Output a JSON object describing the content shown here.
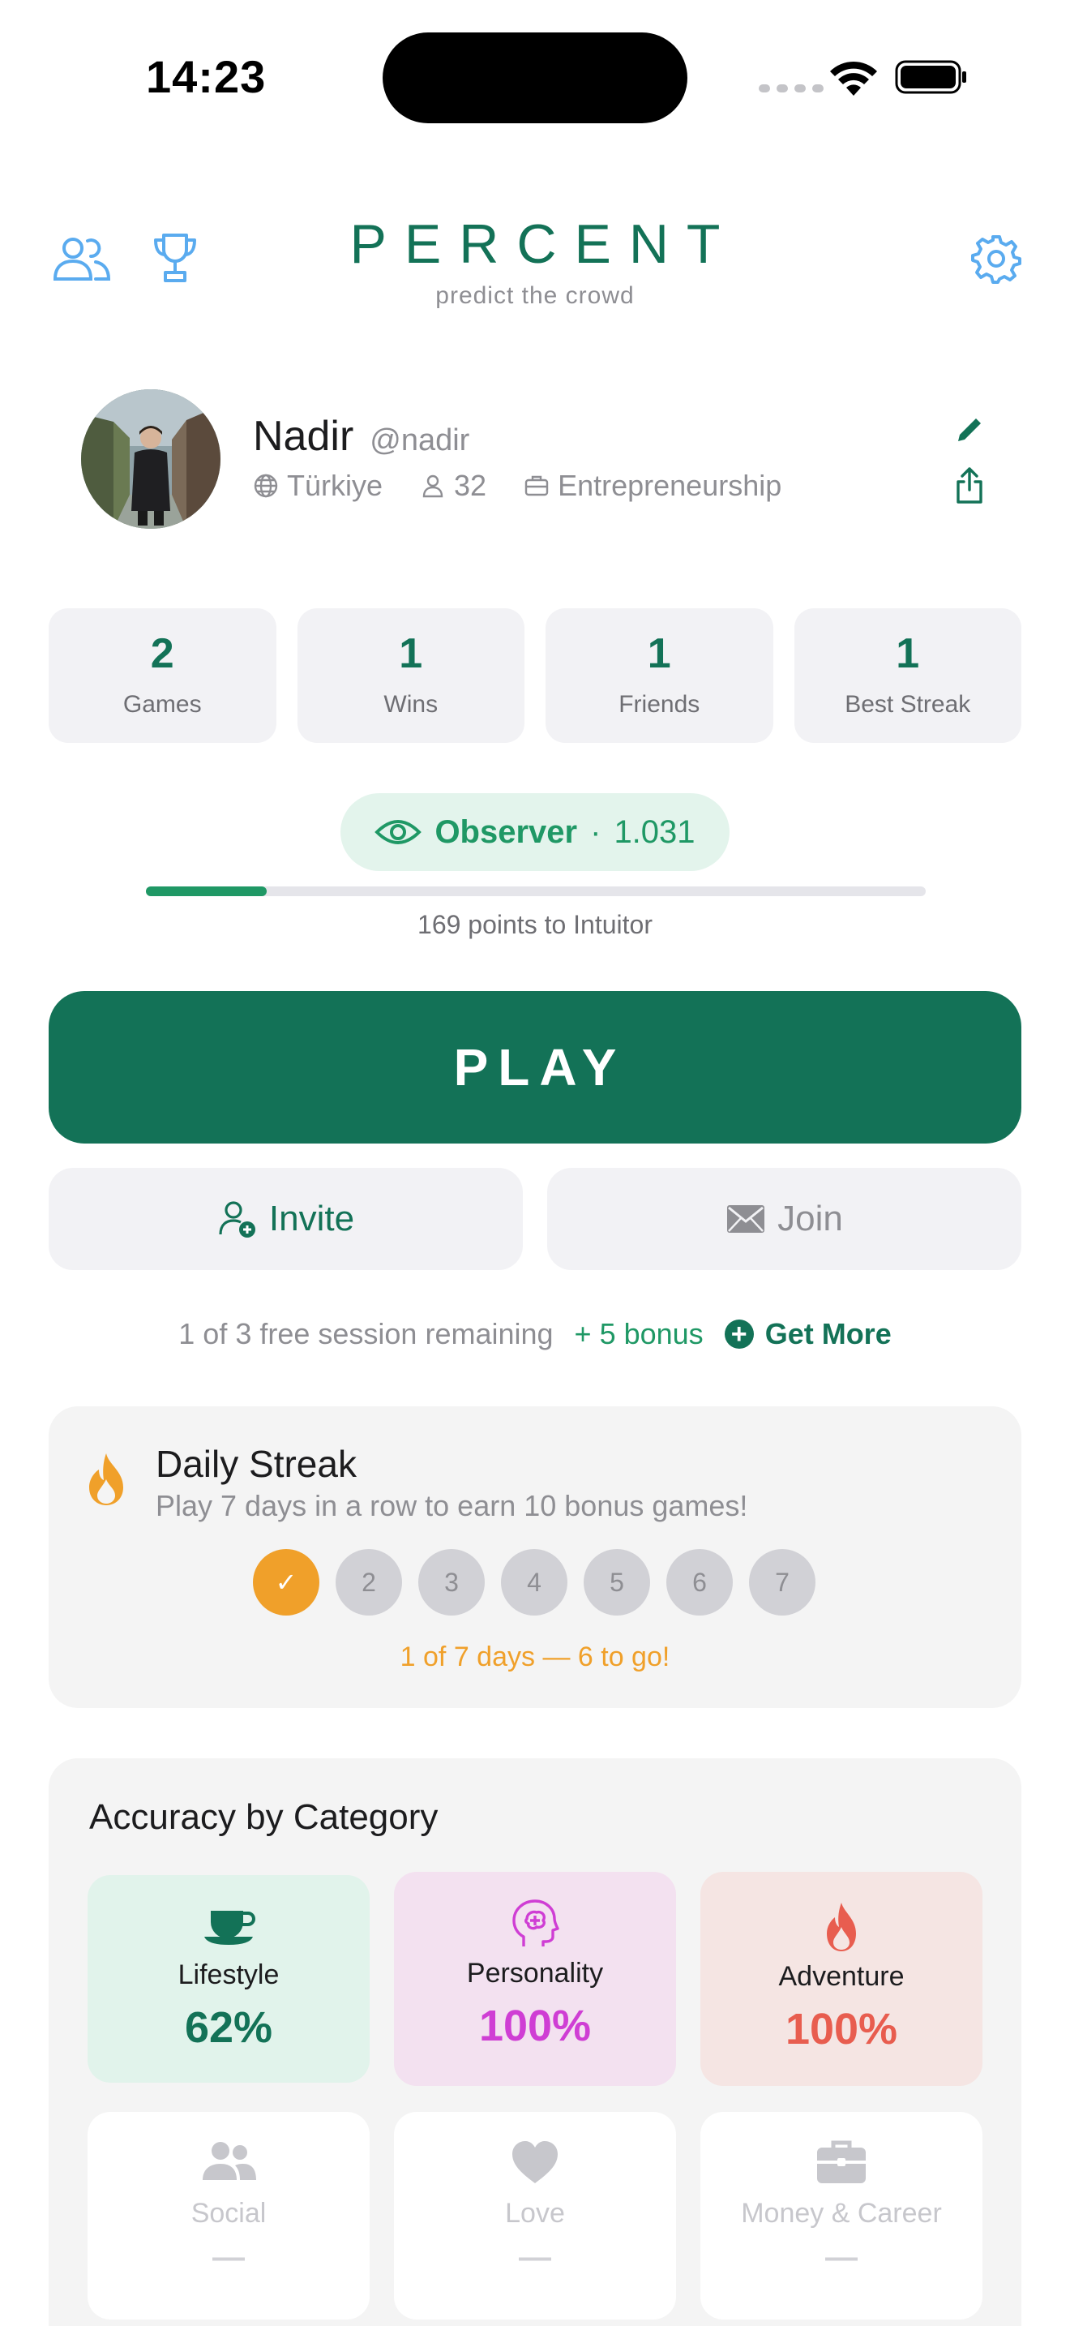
{
  "status_bar": {
    "time": "14:23"
  },
  "header": {
    "title": "PERCENT",
    "subtitle": "predict the crowd",
    "icons": [
      "friends-icon",
      "trophy-icon",
      "gear-icon"
    ]
  },
  "profile": {
    "name": "Nadir",
    "handle": "@nadir",
    "country": "Türkiye",
    "age": "32",
    "occupation": "Entrepreneurship"
  },
  "stats": [
    {
      "value": "2",
      "label": "Games"
    },
    {
      "value": "1",
      "label": "Wins"
    },
    {
      "value": "1",
      "label": "Friends"
    },
    {
      "value": "1",
      "label": "Best Streak"
    }
  ],
  "rank": {
    "name": "Observer",
    "dot": "·",
    "points": "1.031",
    "progress_percent": 15.5,
    "next_text": "169 points to Intuitor"
  },
  "actions": {
    "play_label": "PLAY",
    "invite_label": "Invite",
    "join_label": "Join"
  },
  "session": {
    "remaining_text": "1 of 3 free session remaining",
    "bonus_text": "+ 5 bonus",
    "get_more_label": "Get More",
    "plus_glyph": "+"
  },
  "daily_streak": {
    "title": "Daily Streak",
    "subtitle": "Play 7 days in a row to earn 10 bonus games!",
    "days": [
      "✓",
      "2",
      "3",
      "4",
      "5",
      "6",
      "7"
    ],
    "completed_days": 1,
    "progress_text": "1 of 7 days — 6 to go!"
  },
  "accuracy": {
    "title": "Accuracy by Category",
    "categories": [
      {
        "name": "Lifestyle",
        "value": "62%"
      },
      {
        "name": "Personality",
        "value": "100%"
      },
      {
        "name": "Adventure",
        "value": "100%"
      },
      {
        "name": "Social",
        "value": "—"
      },
      {
        "name": "Love",
        "value": "—"
      },
      {
        "name": "Money & Career",
        "value": "—"
      }
    ]
  },
  "colors": {
    "brand_green": "#137257",
    "accent_green": "#1f9865",
    "streak_orange": "#f0a02a",
    "personality_magenta": "#cf3ed4",
    "adventure_red": "#e85d4f",
    "icon_blue": "#5aabef"
  }
}
